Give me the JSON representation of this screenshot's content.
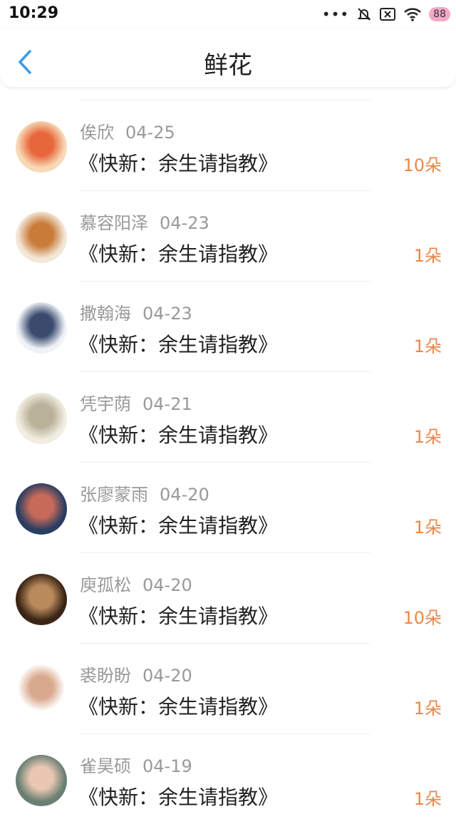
{
  "status": {
    "time": "10:29",
    "battery": "88"
  },
  "header": {
    "title": "鲜花"
  },
  "records": [
    {
      "user": "俟欣",
      "date": "04-25",
      "book": "《快新：余生请指教》",
      "amount": "10朵",
      "avatar_colors": [
        "#f7d9b6",
        "#e8663b"
      ]
    },
    {
      "user": "慕容阳泽",
      "date": "04-23",
      "book": "《快新：余生请指教》",
      "amount": "1朵",
      "avatar_colors": [
        "#f3e7d8",
        "#c97b3a"
      ]
    },
    {
      "user": "撒翰海",
      "date": "04-23",
      "book": "《快新：余生请指教》",
      "amount": "1朵",
      "avatar_colors": [
        "#eef2f7",
        "#3a4b6e"
      ]
    },
    {
      "user": "凭宇荫",
      "date": "04-21",
      "book": "《快新：余生请指教》",
      "amount": "1朵",
      "avatar_colors": [
        "#f1ede0",
        "#b9b19a"
      ]
    },
    {
      "user": "张廖蒙雨",
      "date": "04-20",
      "book": "《快新：余生请指教》",
      "amount": "1朵",
      "avatar_colors": [
        "#2b3e61",
        "#c86a5a"
      ]
    },
    {
      "user": "庾孤松",
      "date": "04-20",
      "book": "《快新：余生请指教》",
      "amount": "10朵",
      "avatar_colors": [
        "#3a2415",
        "#b98a5c"
      ]
    },
    {
      "user": "裘盼盼",
      "date": "04-20",
      "book": "《快新：余生请指教》",
      "amount": "1朵",
      "avatar_colors": [
        "#ffffff",
        "#d9a98d"
      ]
    },
    {
      "user": "雀昊硕",
      "date": "04-19",
      "book": "《快新：余生请指教》",
      "amount": "1朵",
      "avatar_colors": [
        "#6a7f73",
        "#e9c7b3"
      ]
    }
  ]
}
